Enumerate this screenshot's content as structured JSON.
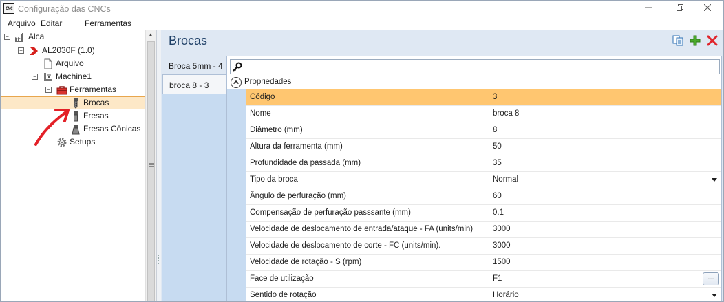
{
  "window": {
    "title": "Configuração das CNCs",
    "app_icon_text": "CNC"
  },
  "menu": {
    "items": [
      "Arquivo",
      "Editar",
      "Ferramentas"
    ]
  },
  "tree": {
    "nodes": [
      {
        "label": "Alca",
        "icon": "factory-icon",
        "expander": "minus"
      },
      {
        "label": "AL2030F (1.0)",
        "icon": "red-chevron-icon",
        "expander": "minus"
      },
      {
        "label": "Arquivo",
        "icon": "document-icon",
        "expander": ""
      },
      {
        "label": "Machine1",
        "icon": "machine-icon",
        "expander": "minus"
      },
      {
        "label": "Ferramentas",
        "icon": "toolbox-icon",
        "expander": "minus"
      },
      {
        "label": "Brocas",
        "icon": "drill-bit-icon",
        "expander": "",
        "selected": true
      },
      {
        "label": "Fresas",
        "icon": "end-mill-icon",
        "expander": ""
      },
      {
        "label": "Fresas Cônicas",
        "icon": "conical-mill-icon",
        "expander": ""
      },
      {
        "label": "Setups",
        "icon": "gear-icon",
        "expander": ""
      }
    ]
  },
  "content": {
    "title": "Brocas",
    "toolbar": {
      "copy_icon": "copy-icon",
      "add_icon": "plus-icon",
      "delete_icon": "delete-x-icon"
    },
    "tabs": [
      {
        "label": "Broca 5mm - 4",
        "active": false
      },
      {
        "label": "broca 8 - 3",
        "active": true
      }
    ]
  },
  "grid": {
    "search": {
      "value": "",
      "icon": "search-key-icon"
    },
    "category": "Propriedades",
    "rows": [
      {
        "name": "Código",
        "value": "3",
        "selected": true
      },
      {
        "name": "Nome",
        "value": "broca 8"
      },
      {
        "name": "Diâmetro (mm)",
        "value": "8"
      },
      {
        "name": "Altura da ferramenta (mm)",
        "value": "50"
      },
      {
        "name": "Profundidade da passada (mm)",
        "value": "35"
      },
      {
        "name": "Tipo da broca",
        "value": "Normal",
        "editor": "dropdown"
      },
      {
        "name": "Ângulo de perfuração (mm)",
        "value": "60"
      },
      {
        "name": "Compensação de perfuração passsante (mm)",
        "value": "0.1"
      },
      {
        "name": "Velocidade de deslocamento de entrada/ataque - FA (units/min)",
        "value": "3000"
      },
      {
        "name": "Velocidade de deslocamento de corte - FC (units/min).",
        "value": "3000"
      },
      {
        "name": "Velocidade de rotação - S (rpm)",
        "value": "1500"
      },
      {
        "name": "Face de utilização",
        "value": "F1",
        "editor": "ellipsis",
        "editor_label": "..."
      },
      {
        "name": "Sentido de rotação",
        "value": "Horário",
        "editor": "dropdown"
      }
    ]
  },
  "colors": {
    "selection": "#ffc670",
    "tree_selection": "#fde8c7",
    "accent_title": "#1e3f66",
    "panel_bg": "#dfe8f3"
  }
}
